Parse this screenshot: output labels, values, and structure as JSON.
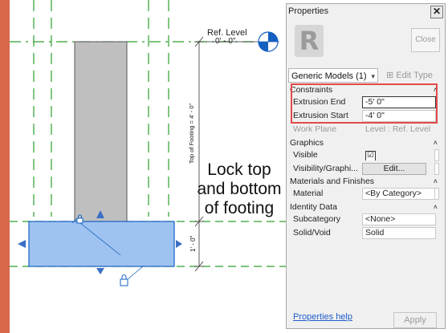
{
  "canvas": {
    "ref_level_name": "Ref. Level",
    "ref_level_elevation": "0' - 0\"",
    "dimension_label_vertical": "Top of Footing = 4' - 0\"",
    "dimension_label_footing": "1' - 0\"",
    "callout_lines": [
      "Lock top",
      "and bottom",
      "of footing"
    ],
    "colors": {
      "column_fill": "#bfbfbf",
      "footing_fill": "#9fc3f0",
      "reference_line": "#2ca02c",
      "accent_red": "#e34a4a",
      "level_symbol": "#1560c0"
    }
  },
  "properties": {
    "title": "Properties",
    "close_icon": "close-x-icon",
    "type_icon_letter": "R",
    "close_button_label": "Close",
    "type_selector_value": "Generic Models (1)",
    "edit_type_label": "Edit Type",
    "sections": {
      "constraints": {
        "label": "Constraints",
        "rows": [
          {
            "label": "Extrusion End",
            "value": "-5'  0\""
          },
          {
            "label": "Extrusion Start",
            "value": "-4'  0\""
          },
          {
            "label": "Work Plane",
            "value": "Level : Ref. Level"
          }
        ]
      },
      "graphics": {
        "label": "Graphics",
        "rows": [
          {
            "label": "Visible",
            "value": "☑"
          },
          {
            "label": "Visibility/Graphi...",
            "value": "Edit..."
          }
        ]
      },
      "materials": {
        "label": "Materials and Finishes",
        "rows": [
          {
            "label": "Material",
            "value": "<By Category>"
          }
        ]
      },
      "identity": {
        "label": "Identity Data",
        "rows": [
          {
            "label": "Subcategory",
            "value": "<None>"
          },
          {
            "label": "Solid/Void",
            "value": "Solid"
          }
        ]
      }
    },
    "help_link": "Properties help",
    "apply_label": "Apply"
  }
}
